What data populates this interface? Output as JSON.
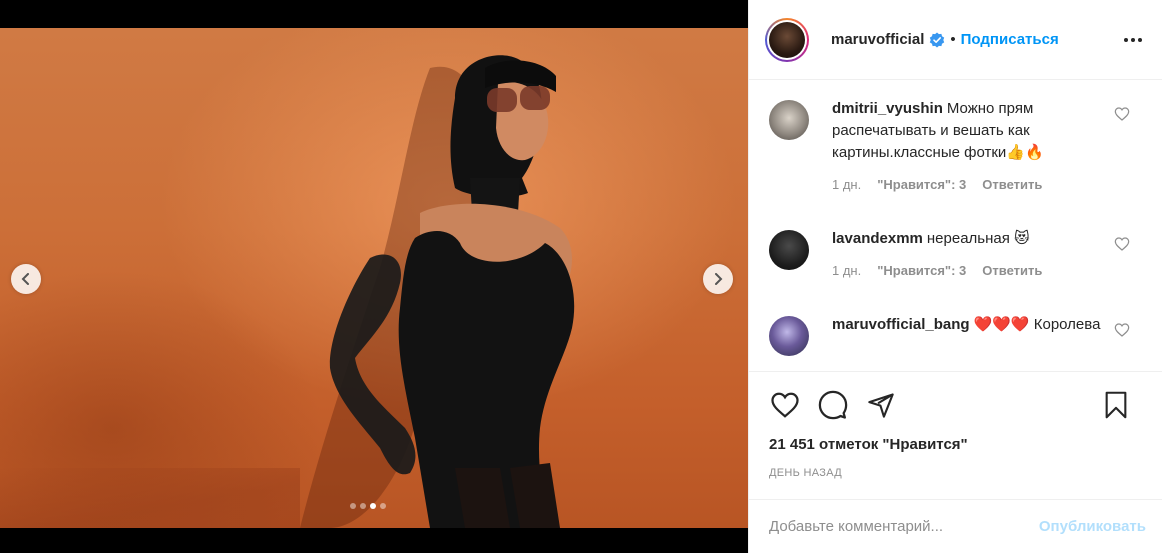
{
  "post": {
    "username": "maruvofficial",
    "separator": "•",
    "follow_label": "Подписаться",
    "likes_text": "21 451 отметок \"Нравится\"",
    "date_text": "День назад",
    "add_comment_placeholder": "Добавьте комментарий...",
    "publish_label": "Опубликовать",
    "carousel": {
      "slide_count": 4,
      "active_index": 2
    }
  },
  "comments": [
    {
      "username": "dmitrii_vyushin",
      "text": "Можно прям распечатывать и вешать как картины.классные фотки👍🔥",
      "time": "1 дн.",
      "likes": "\"Нравится\": 3",
      "reply": "Ответить"
    },
    {
      "username": "lavandexmm",
      "text": "нереальная 😻",
      "time": "1 дн.",
      "likes": "\"Нравится\": 3",
      "reply": "Ответить"
    },
    {
      "username": "maruvofficial_bang",
      "text": "❤️❤️❤️ Королева"
    }
  ],
  "colors": {
    "accent": "#0095f6",
    "publish_disabled": "#b2dffc",
    "secondary_text": "#8e8e8e",
    "border": "#efefef",
    "verified": "#3897f0"
  },
  "icons": {
    "prev": "chevron-left-icon",
    "next": "chevron-right-icon",
    "like": "heart-icon",
    "comment": "comment-icon",
    "share": "paper-plane-icon",
    "save": "bookmark-icon",
    "more": "more-horizontal-icon",
    "verified": "verified-badge-icon"
  }
}
